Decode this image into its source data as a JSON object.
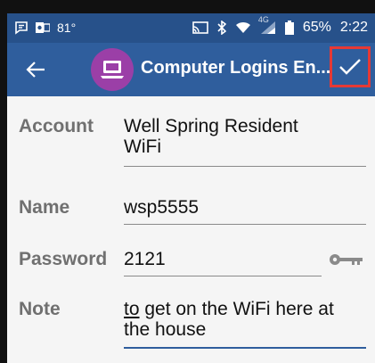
{
  "status_bar": {
    "temperature": "81°",
    "battery_percent": "65%",
    "time": "2:22",
    "network_badge": "4G"
  },
  "app_bar": {
    "title": "Computer Logins En..."
  },
  "form": {
    "account_label": "Account",
    "account_line1": "Well Spring Resident",
    "account_line2": "WiFi",
    "name_label": "Name",
    "name_value": "wsp5555",
    "password_label": "Password",
    "password_value": "2121",
    "note_label": "Note",
    "note_first_word": "to",
    "note_line1_rest": " get on the WiFi here at",
    "note_line2": "the house"
  },
  "colors": {
    "status_bar": "#27518a",
    "app_bar": "#2f5e9d",
    "app_icon_bg": "#9b3fa7",
    "highlight_box": "#e53935"
  }
}
